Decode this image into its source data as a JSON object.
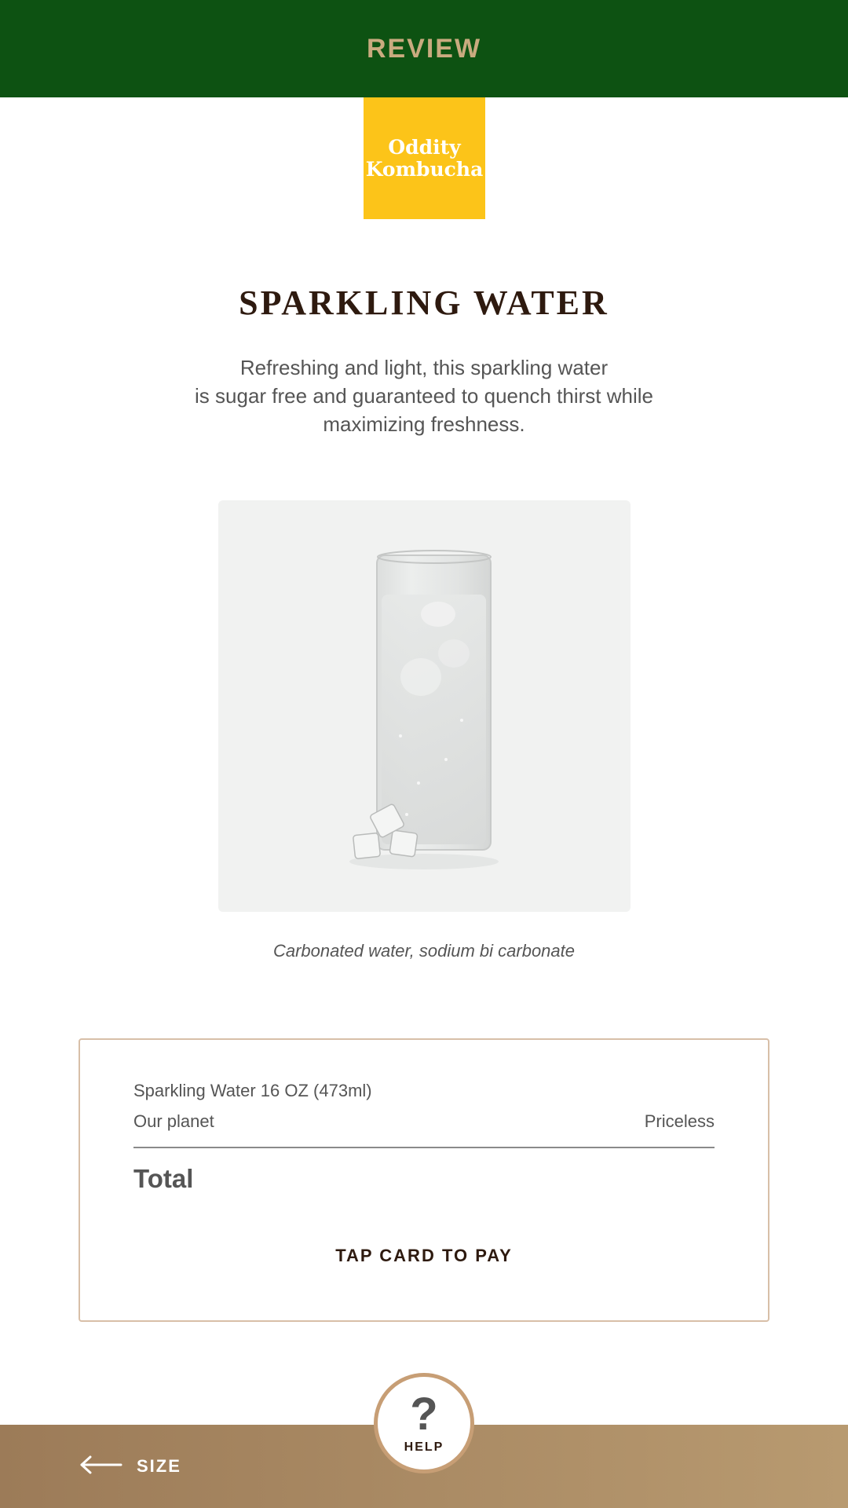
{
  "header": {
    "title": "REVIEW"
  },
  "logo": {
    "line1": "Oddity",
    "line2": "Kombucha"
  },
  "product": {
    "name": "SPARKLING WATER",
    "description_lines": [
      "Refreshing and light, this sparkling water",
      "is sugar free and guaranteed to quench thirst while",
      "maximizing freshness."
    ],
    "ingredients": "Carbonated water, sodium bi carbonate"
  },
  "summary": {
    "item_line": "Sparkling Water 16 OZ (473ml)",
    "planet_label": "Our planet",
    "planet_value": "Priceless",
    "total_label": "Total",
    "pay_label": "TAP CARD TO PAY"
  },
  "footer": {
    "back_label": "SIZE",
    "help_label": "HELP",
    "help_symbol": "?"
  },
  "colors": {
    "header_bg": "#0d5212",
    "header_text": "#c9ab7f",
    "logo_bg": "#fcc419",
    "title_text": "#2e1a0f",
    "footer_bg_start": "#9c7b58",
    "footer_bg_end": "#b89a70",
    "card_border": "#d8bfa8"
  }
}
